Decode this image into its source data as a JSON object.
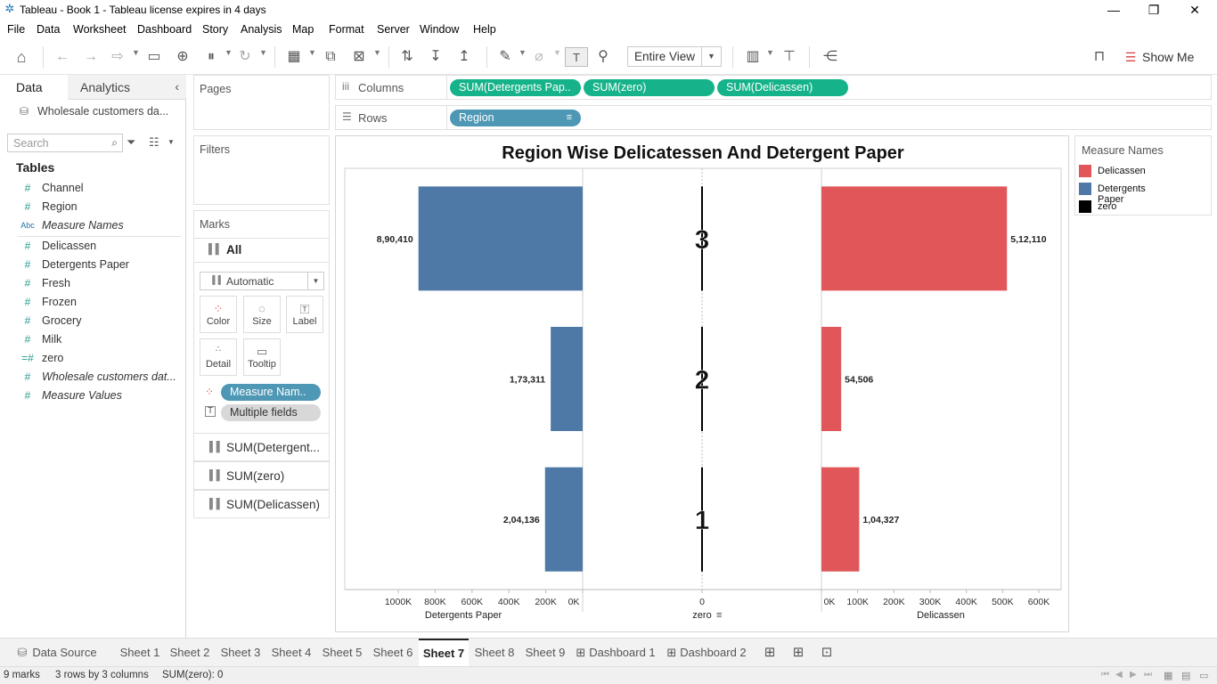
{
  "window": {
    "title": "Tableau - Book 1 - Tableau license expires in 4 days"
  },
  "menu": [
    "File",
    "Data",
    "Worksheet",
    "Dashboard",
    "Story",
    "Analysis",
    "Map",
    "Format",
    "Server",
    "Window",
    "Help"
  ],
  "toolbar": {
    "view_mode": "Entire View",
    "show_me": "Show Me"
  },
  "left_pane": {
    "tabs": [
      "Data",
      "Analytics"
    ],
    "datasource": "Wholesale customers da...",
    "search_placeholder": "Search",
    "tables_heading": "Tables",
    "fields": [
      {
        "icon": "#",
        "label": "Channel"
      },
      {
        "icon": "#",
        "label": "Region"
      },
      {
        "icon": "Abc",
        "label": "Measure Names"
      },
      {
        "icon": "#",
        "label": "Delicassen"
      },
      {
        "icon": "#",
        "label": "Detergents Paper"
      },
      {
        "icon": "#",
        "label": "Fresh"
      },
      {
        "icon": "#",
        "label": "Frozen"
      },
      {
        "icon": "#",
        "label": "Grocery"
      },
      {
        "icon": "#",
        "label": "Milk"
      },
      {
        "icon": "=#",
        "label": "zero"
      },
      {
        "icon": "#",
        "label": "Wholesale customers dat..."
      },
      {
        "icon": "#",
        "label": "Measure Values"
      }
    ]
  },
  "cards": {
    "pages": "Pages",
    "filters": "Filters",
    "marks": "Marks",
    "marks_all": "All",
    "mark_type": "Automatic",
    "buttons": [
      "Color",
      "Size",
      "Label",
      "Detail",
      "Tooltip"
    ],
    "pill_color": "Measure Nam..",
    "pill_label": "Multiple fields",
    "measures": [
      "SUM(Detergent...",
      "SUM(zero)",
      "SUM(Delicassen)"
    ]
  },
  "shelves": {
    "columns_label": "Columns",
    "columns": [
      "SUM(Detergents Pap..",
      "SUM(zero)",
      "SUM(Delicassen)"
    ],
    "rows_label": "Rows",
    "rows": [
      "Region"
    ]
  },
  "legend": {
    "title": "Measure Names",
    "items": [
      {
        "label": "Delicassen",
        "color": "#e15759"
      },
      {
        "label": "Detergents Paper",
        "color": "#4e79a7"
      },
      {
        "label": "zero",
        "color": "#000000"
      }
    ]
  },
  "chart_data": {
    "type": "bar",
    "title": "Region Wise Delicatessen And Detergent Paper",
    "categories": [
      "3",
      "2",
      "1"
    ],
    "series": [
      {
        "name": "Detergents Paper",
        "values": [
          890410,
          173311,
          204136
        ],
        "labels": [
          "8,90,410",
          "1,73,311",
          "2,04,136"
        ],
        "color": "#4e79a7",
        "axis_label": "Detergents Paper",
        "ticks": [
          "1000K",
          "800K",
          "600K",
          "400K",
          "200K",
          "0K"
        ],
        "xlim": [
          1000000,
          0
        ]
      },
      {
        "name": "zero",
        "values": [
          0,
          0,
          0
        ],
        "color": "#000000",
        "axis_label": "zero",
        "ticks": [
          "0"
        ]
      },
      {
        "name": "Delicassen",
        "values": [
          512110,
          54506,
          104327
        ],
        "labels": [
          "5,12,110",
          "54,506",
          "1,04,327"
        ],
        "color": "#e15759",
        "axis_label": "Delicassen",
        "ticks": [
          "0K",
          "100K",
          "200K",
          "300K",
          "400K",
          "500K",
          "600K"
        ],
        "xlim": [
          0,
          600000
        ]
      }
    ],
    "grid": false
  },
  "sheet_tabs": {
    "datasource": "Data Source",
    "tabs": [
      "Sheet 1",
      "Sheet 2",
      "Sheet 3",
      "Sheet 4",
      "Sheet 5",
      "Sheet 6",
      "Sheet 7",
      "Sheet 8",
      "Sheet 9",
      "Dashboard 1",
      "Dashboard 2"
    ],
    "active": "Sheet 7"
  },
  "status": {
    "marks": "9 marks",
    "grid": "3 rows by 3 columns",
    "sum": "SUM(zero): 0"
  }
}
